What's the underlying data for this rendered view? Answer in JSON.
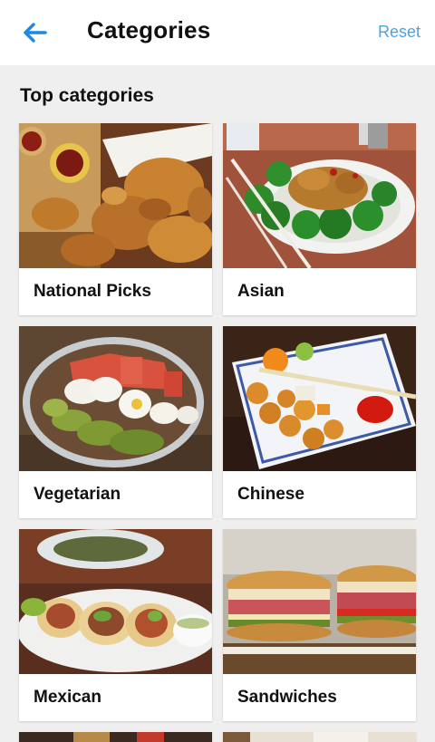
{
  "header": {
    "back_icon": "arrow-left-icon",
    "title": "Categories",
    "reset_label": "Reset",
    "accent_color": "#1e88e5",
    "reset_color": "#4aa3e6"
  },
  "section": {
    "title": "Top categories"
  },
  "categories": [
    {
      "label": "National Picks"
    },
    {
      "label": "Asian"
    },
    {
      "label": "Vegetarian"
    },
    {
      "label": "Chinese"
    },
    {
      "label": "Mexican"
    },
    {
      "label": "Sandwiches"
    }
  ]
}
